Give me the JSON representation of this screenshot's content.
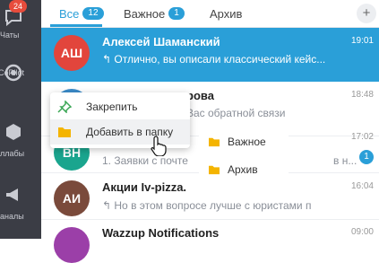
{
  "sidebar": {
    "items": [
      {
        "label": "Чаты",
        "badge": "24",
        "icon": "chat-icon"
      },
      {
        "label": "CoPilot",
        "icon": "copilot-icon"
      },
      {
        "label": "ллабы",
        "icon": "hexagon-icon"
      },
      {
        "label": "аналы",
        "icon": "megaphone-icon"
      }
    ]
  },
  "tabs": [
    {
      "label": "Все",
      "count": "12"
    },
    {
      "label": "Важное",
      "count": "1"
    },
    {
      "label": "Архив"
    }
  ],
  "plus_label": "+",
  "chats": [
    {
      "initials": "АШ",
      "name": "Алексей Шаманский",
      "preview": "↰ Отлично, вы описали классический кейс...",
      "time": "19:01",
      "color": "#e2453c"
    },
    {
      "initials": "",
      "name": "рова",
      "preview": "Вас обратной связи",
      "time": "18:48",
      "color": "#3a8bc9"
    },
    {
      "initials": "ВН",
      "name": "",
      "preview": "1. Заявки с почте",
      "extra": "в н...",
      "time": "17:02",
      "unread": "1",
      "color": "#1aa58e"
    },
    {
      "initials": "АИ",
      "name": "Акции Iv-pizza.",
      "preview": "↰ Но в этом вопросе лучше с юристами п",
      "time": "16:04",
      "color": "#7a4a3b"
    },
    {
      "initials": "",
      "name": "Wazzup Notifications",
      "preview": "",
      "time": "09:00",
      "color": "#9b3fa8"
    }
  ],
  "context_menu": {
    "items": [
      {
        "label": "Закрепить",
        "icon": "pin-icon"
      },
      {
        "label": "Добавить в папку",
        "icon": "folder-icon"
      }
    ]
  },
  "submenu": {
    "items": [
      {
        "label": "Важное",
        "icon": "folder-icon"
      },
      {
        "label": "Архив",
        "icon": "folder-icon"
      }
    ]
  },
  "colors": {
    "accent": "#2a9fd8",
    "sidebar": "#3b3d45",
    "badge": "#e74c3c",
    "folder": "#f4b400",
    "pin": "#3aa655"
  }
}
